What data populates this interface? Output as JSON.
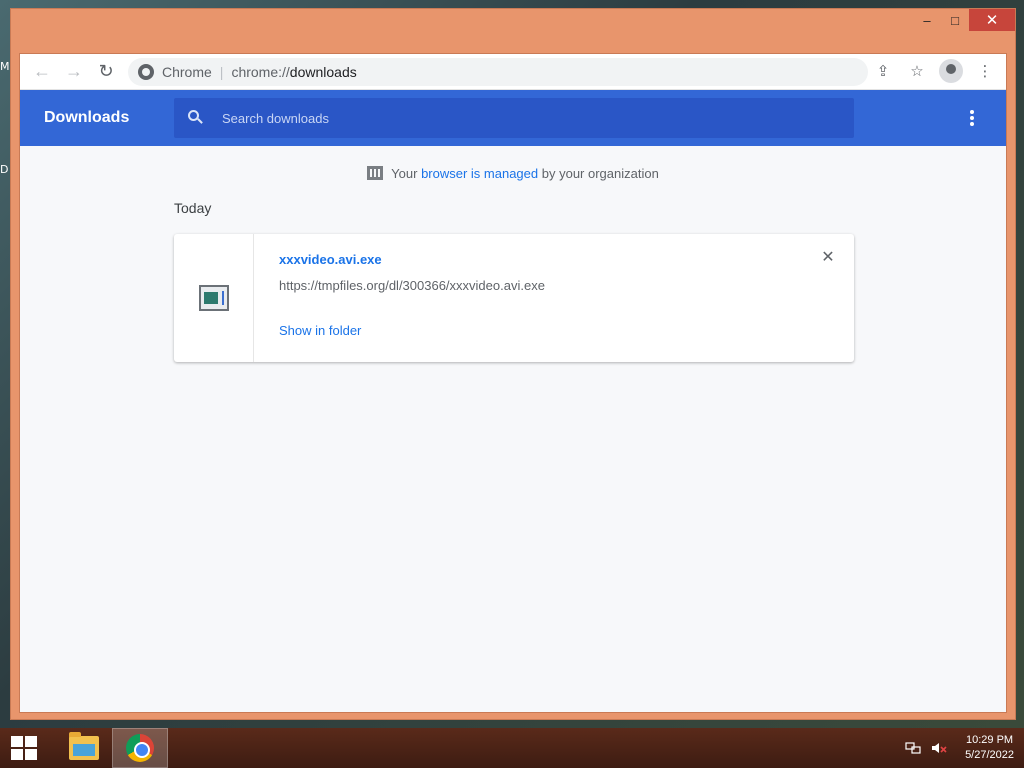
{
  "desktop": {
    "labels": [
      "M",
      "D"
    ]
  },
  "window": {
    "controls": {
      "minimize": "–",
      "maximize": "□",
      "close": "✕"
    }
  },
  "toolbar": {
    "back_icon": "←",
    "forward_icon": "→",
    "reload_icon": "↻",
    "omnibox": {
      "site_label": "Chrome",
      "separator": "|",
      "scheme": "chrome://",
      "path": "downloads"
    },
    "share_icon": "⇪",
    "bookmark_icon": "☆",
    "menu_icon": "⋮"
  },
  "downloads": {
    "title": "Downloads",
    "search_placeholder": "Search downloads",
    "managed": {
      "prefix": "Your",
      "link": "browser is managed",
      "suffix": "by your organization"
    },
    "section": "Today",
    "items": [
      {
        "file_name": "xxxvideo.avi.exe",
        "url": "https://tmpfiles.org/dl/300366/xxxvideo.avi.exe",
        "action": "Show in folder",
        "remove_icon": "✕"
      }
    ]
  },
  "taskbar": {
    "tray": {
      "network_icon": "network-icon",
      "volume_icon": "volume-muted-icon"
    },
    "clock": {
      "time": "10:29 PM",
      "date": "5/27/2022"
    }
  },
  "colors": {
    "header": "#3367d6",
    "link": "#1a73e8",
    "window_frame": "#e8956c"
  }
}
